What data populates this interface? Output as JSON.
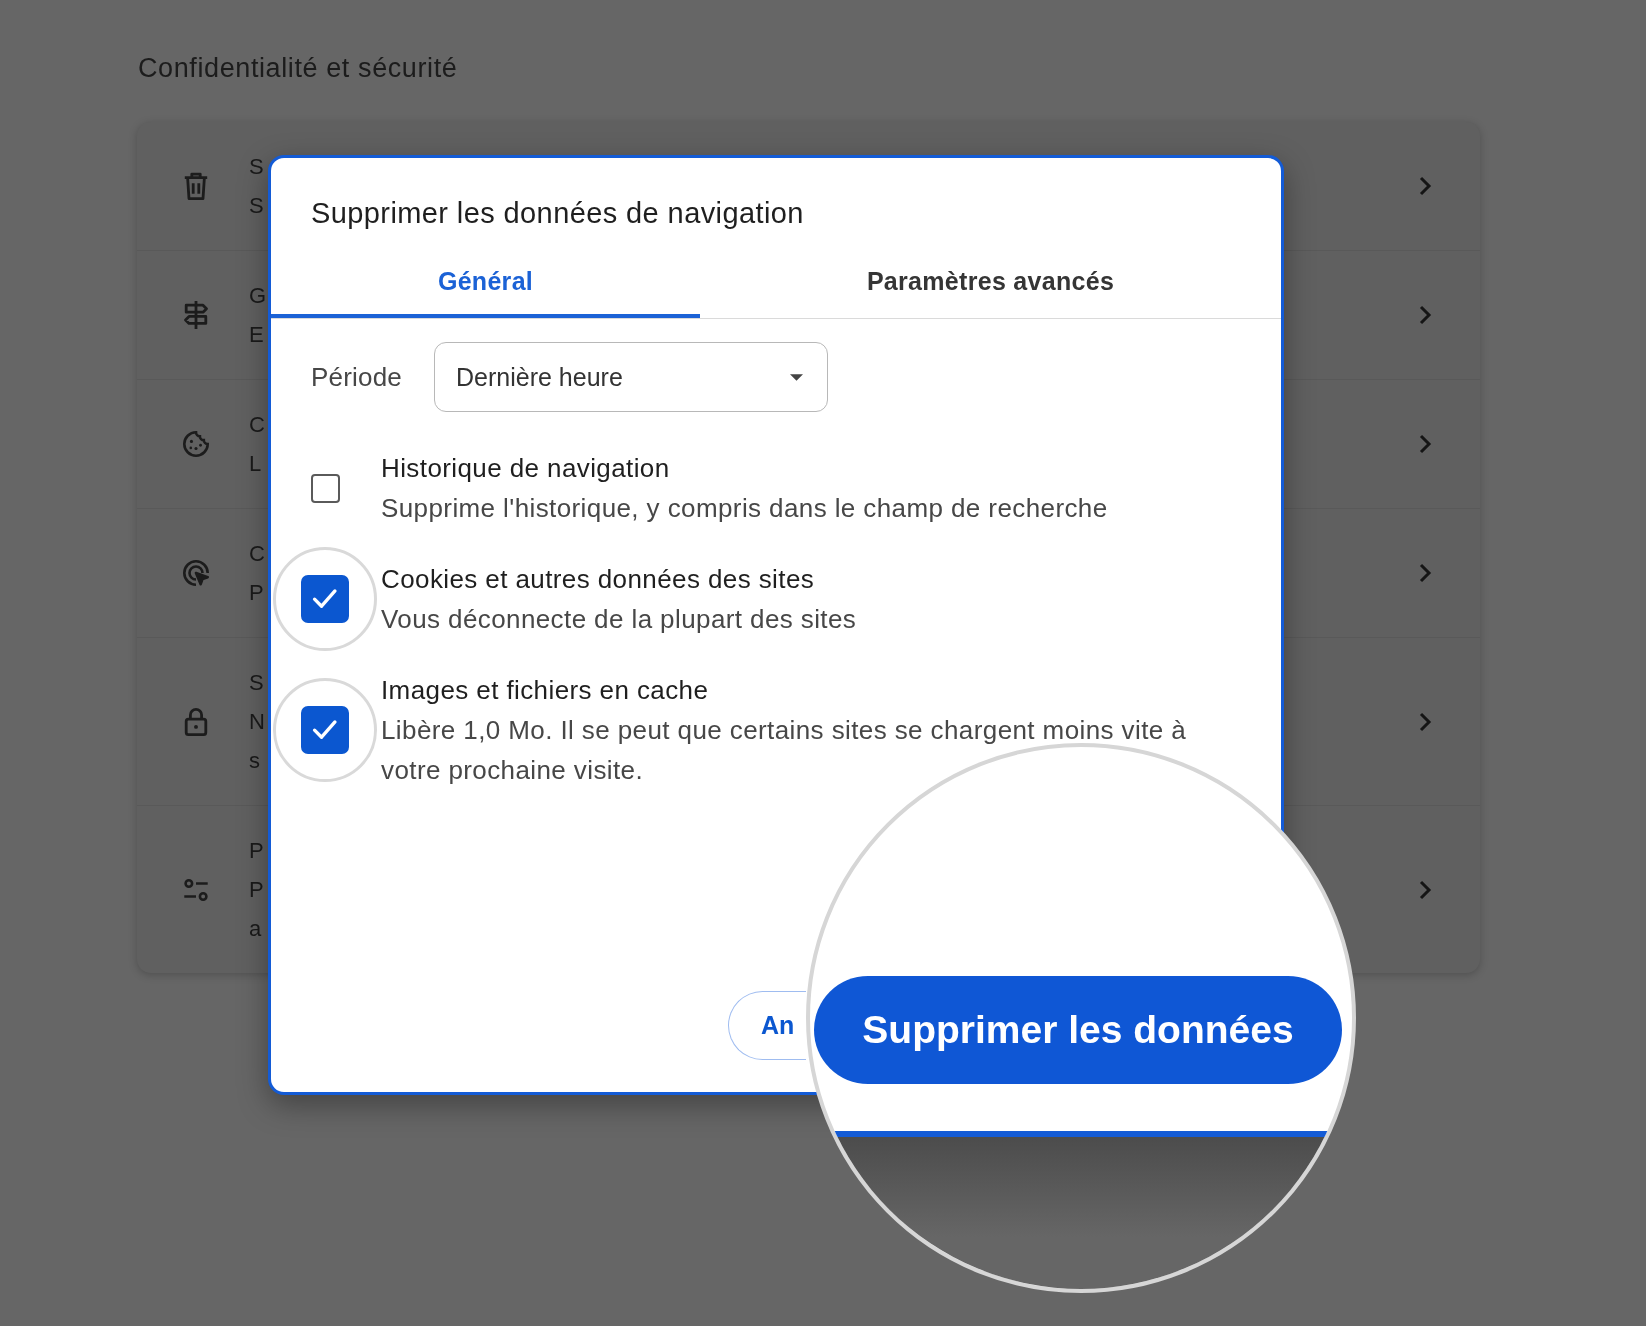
{
  "page": {
    "title": "Confidentialité et sécurité"
  },
  "settings_rows": [
    {
      "lines": [
        "S",
        "S"
      ]
    },
    {
      "lines": [
        "G",
        "E"
      ]
    },
    {
      "lines": [
        "C",
        "L"
      ]
    },
    {
      "lines": [
        "C",
        "P"
      ]
    },
    {
      "lines": [
        "S",
        "N",
        "s"
      ]
    },
    {
      "lines": [
        "P",
        "P",
        "a"
      ]
    }
  ],
  "dialog": {
    "title": "Supprimer les données de navigation",
    "tabs": [
      {
        "label": "Général",
        "selected": true
      },
      {
        "label": "Paramètres avancés",
        "selected": false
      }
    ],
    "period": {
      "label": "Période",
      "value": "Dernière heure"
    },
    "options": [
      {
        "title": "Historique de navigation",
        "description": "Supprime l'historique, y compris dans le champ de recherche",
        "checked": false,
        "highlighted": false
      },
      {
        "title": "Cookies et autres données des sites",
        "description": "Vous déconnecte de la plupart des sites",
        "checked": true,
        "highlighted": true
      },
      {
        "title": "Images et fichiers en cache",
        "description": "Libère 1,0 Mo. Il se peut que certains sites se chargent moins vite à votre prochaine visite.",
        "checked": true,
        "highlighted": true
      }
    ],
    "cancel_button": {
      "label": "An"
    }
  },
  "magnifier": {
    "button": {
      "label": "Supprimer les données"
    }
  }
}
